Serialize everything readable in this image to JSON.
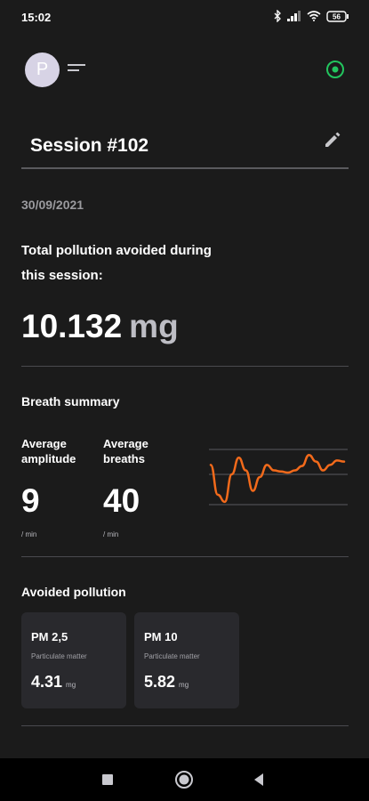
{
  "status_bar": {
    "time": "15:02",
    "icons": [
      "bluetooth-icon",
      "signal-icon",
      "wifi-icon",
      "battery-icon"
    ],
    "battery_label": "56"
  },
  "app_bar": {
    "avatar_letter": "P",
    "icons": [
      "menu-icon",
      "live-status-icon"
    ],
    "accent_color": "#22c55e"
  },
  "session": {
    "title": "Session #102",
    "date": "30/09/2021",
    "edit_icon": "pencil-icon"
  },
  "pollution_total": {
    "label": "Total pollution avoided during this session:",
    "value": "10.132",
    "unit": "mg"
  },
  "breath_summary": {
    "title": "Breath summary",
    "stats": [
      {
        "label_line1": "Average",
        "label_line2": "amplitude",
        "value": "9",
        "unit": "/ min"
      },
      {
        "label_line1": "Average",
        "label_line2": "breaths",
        "value": "40",
        "unit": "/ min"
      }
    ],
    "chart_color": "#f26a1b"
  },
  "chart_data": {
    "type": "line",
    "title": "",
    "xlabel": "",
    "ylabel": "",
    "grid": true,
    "series": [
      {
        "values": [
          0.72,
          0.18,
          0.05,
          0.55,
          0.85,
          0.62,
          0.25,
          0.5,
          0.72,
          0.62,
          0.6,
          0.58,
          0.62,
          0.7,
          0.9,
          0.78,
          0.62,
          0.72,
          0.8,
          0.78
        ]
      }
    ]
  },
  "avoided_pollution": {
    "title": "Avoided pollution",
    "cards": [
      {
        "title": "PM 2,5",
        "subtitle": "Particulate matter",
        "value": "4.31",
        "unit": "mg"
      },
      {
        "title": "PM 10",
        "subtitle": "Particulate matter",
        "value": "5.82",
        "unit": "mg"
      }
    ]
  },
  "nav_bar": {
    "buttons": [
      "recent-apps-button",
      "home-button",
      "back-button"
    ]
  }
}
